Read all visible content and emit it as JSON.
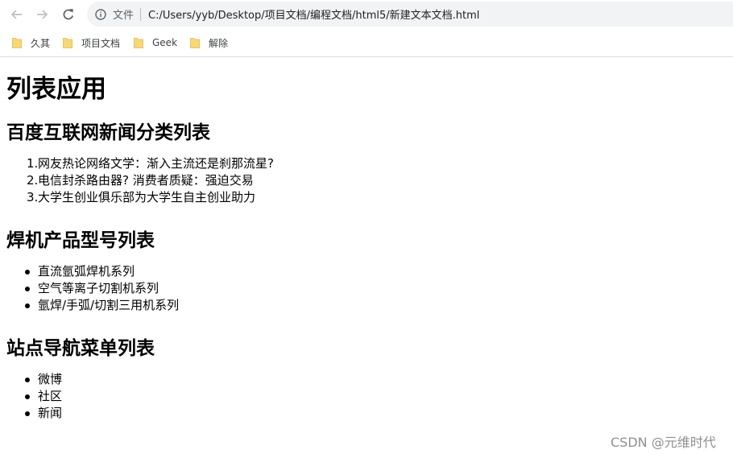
{
  "browser": {
    "security_label": "文件",
    "url": "C:/Users/yyb/Desktop/项目文档/编程文档/html5/新建文本文档.html",
    "bookmarks": [
      {
        "label": "久其"
      },
      {
        "label": "项目文档"
      },
      {
        "label": "Geek"
      },
      {
        "label": "解除"
      }
    ]
  },
  "page": {
    "title": "列表应用",
    "sections": [
      {
        "heading": "百度互联网新闻分类列表",
        "list_type": "ordered",
        "items": [
          "网友热论网络文学：渐入主流还是刹那流星?",
          "电信封杀路由器? 消费者质疑：强迫交易",
          "大学生创业俱乐部为大学生自主创业助力"
        ]
      },
      {
        "heading": "焊机产品型号列表",
        "list_type": "unordered",
        "items": [
          "直流氩弧焊机系列",
          "空气等离子切割机系列",
          "氩焊/手弧/切割三用机系列"
        ]
      },
      {
        "heading": "站点导航菜单列表",
        "list_type": "unordered",
        "items": [
          "微博",
          "社区",
          "新闻"
        ]
      }
    ]
  },
  "watermark": "CSDN @元维时代",
  "colors": {
    "address_bar_bg": "#f1f3f4",
    "folder_icon": "#f8d775",
    "toolbar_icon": "#5f6368",
    "disabled_icon": "#bdc1c6"
  },
  "icons": {
    "back": "arrow-left-icon",
    "forward": "arrow-right-icon",
    "reload": "reload-icon",
    "info": "info-icon",
    "bookmark": "folder-icon"
  }
}
